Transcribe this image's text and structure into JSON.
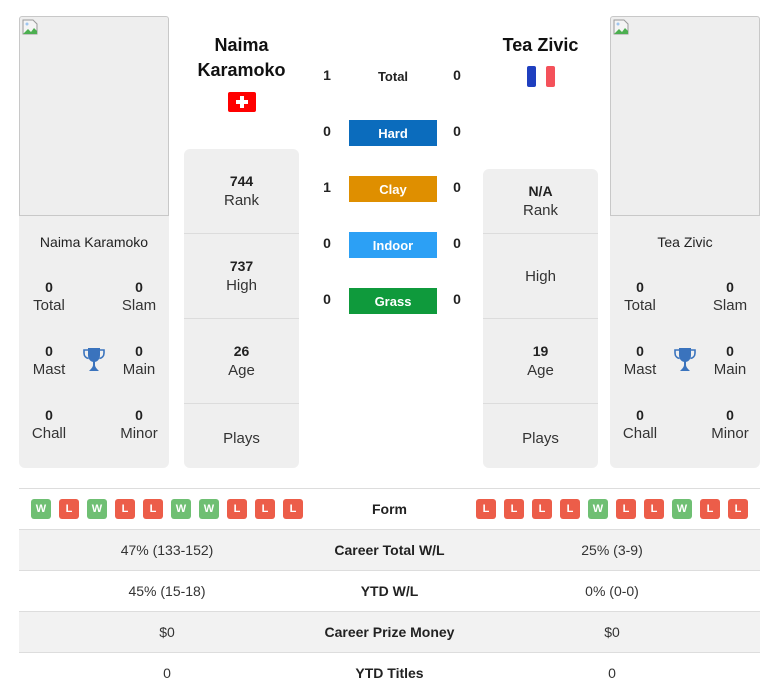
{
  "players": [
    {
      "name_line1": "Naima",
      "name_line2": "Karamoko",
      "full_name": "Naima Karamoko",
      "flag": "switzerland-flag",
      "titles": {
        "total": "0",
        "total_label": "Total",
        "slam": "0",
        "slam_label": "Slam",
        "mast": "0",
        "mast_label": "Mast",
        "main": "0",
        "main_label": "Main",
        "chall": "0",
        "chall_label": "Chall",
        "minor": "0",
        "minor_label": "Minor"
      },
      "stats": [
        {
          "value": "744",
          "label": "Rank"
        },
        {
          "value": "737",
          "label": "High"
        },
        {
          "value": "26",
          "label": "Age"
        },
        {
          "value": "",
          "label": "Plays"
        }
      ],
      "form": [
        "W",
        "L",
        "W",
        "L",
        "L",
        "W",
        "W",
        "L",
        "L",
        "L"
      ],
      "career_total_wl": "47% (133-152)",
      "ytd_wl": "45% (15-18)",
      "career_prize_money": "$0",
      "ytd_titles": "0"
    },
    {
      "name_line1": "Tea Zivic",
      "full_name": "Tea Zivic",
      "flag": "france-flag",
      "titles": {
        "total": "0",
        "total_label": "Total",
        "slam": "0",
        "slam_label": "Slam",
        "mast": "0",
        "mast_label": "Mast",
        "main": "0",
        "main_label": "Main",
        "chall": "0",
        "chall_label": "Chall",
        "minor": "0",
        "minor_label": "Minor"
      },
      "stats": [
        {
          "value": "N/A",
          "label": "Rank"
        },
        {
          "value": "",
          "label": "High"
        },
        {
          "value": "19",
          "label": "Age"
        },
        {
          "value": "",
          "label": "Plays"
        }
      ],
      "form": [
        "L",
        "L",
        "L",
        "L",
        "W",
        "L",
        "L",
        "W",
        "L",
        "L"
      ],
      "career_total_wl": "25% (3-9)",
      "ytd_wl": "0% (0-0)",
      "career_prize_money": "$0",
      "ytd_titles": "0"
    }
  ],
  "h2h": {
    "total": {
      "label": "Total",
      "p1": "1",
      "p2": "0"
    },
    "surfaces": [
      {
        "label": "Hard",
        "p1": "0",
        "p2": "0",
        "color": "#0b6cbd"
      },
      {
        "label": "Clay",
        "p1": "1",
        "p2": "0",
        "color": "#df8f00"
      },
      {
        "label": "Indoor",
        "p1": "0",
        "p2": "0",
        "color": "#2ca0f5"
      },
      {
        "label": "Grass",
        "p1": "0",
        "p2": "0",
        "color": "#0f9a3c"
      }
    ]
  },
  "comparison": {
    "form_label": "Form",
    "career_total_wl_label": "Career Total W/L",
    "ytd_wl_label": "YTD W/L",
    "career_prize_money_label": "Career Prize Money",
    "ytd_titles_label": "YTD Titles"
  },
  "colors": {
    "win": "#6fbf73",
    "loss": "#ec5d49",
    "trophy": "#3a73bd",
    "card_bg": "#efefef"
  }
}
